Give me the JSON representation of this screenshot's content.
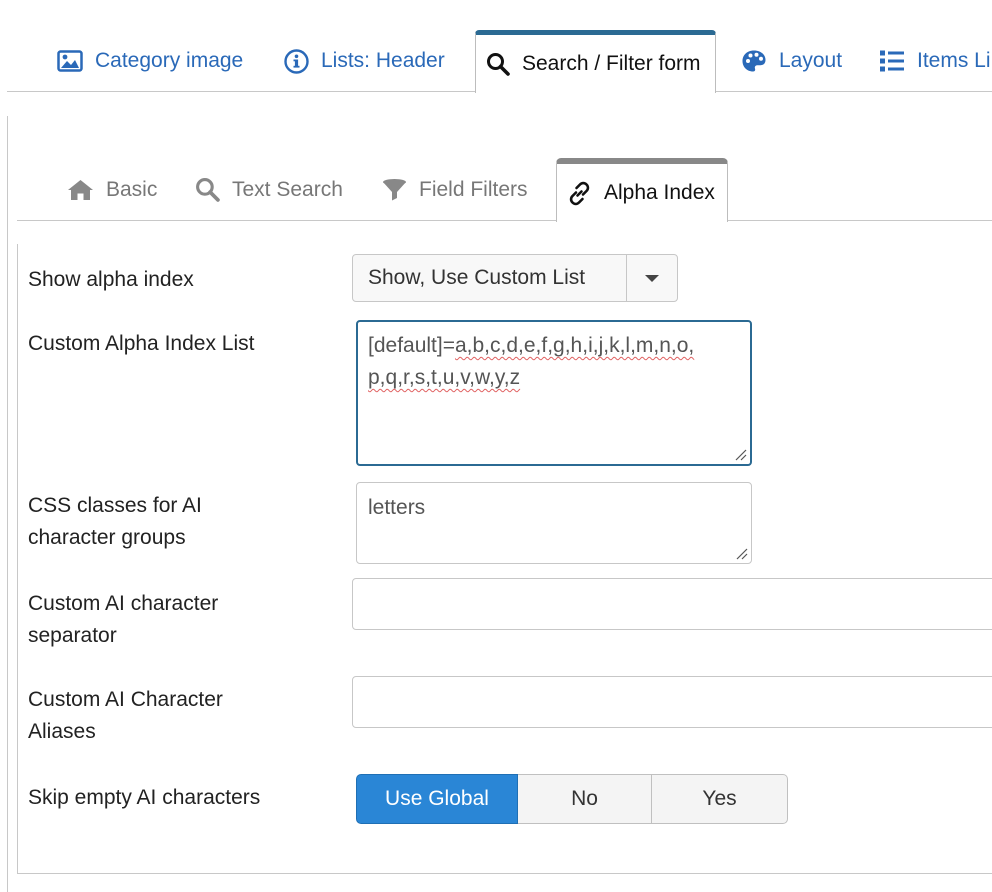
{
  "top_tabs": [
    {
      "label": "Category image",
      "icon": "image-icon"
    },
    {
      "label": "Lists: Header",
      "icon": "info-circle-icon"
    },
    {
      "label": "Search / Filter form",
      "icon": "search-icon",
      "active": true
    },
    {
      "label": "Layout",
      "icon": "palette-icon"
    },
    {
      "label": "Items Li",
      "icon": "list-icon"
    }
  ],
  "sub_tabs": [
    {
      "label": "Basic",
      "icon": "home-icon"
    },
    {
      "label": "Text Search",
      "icon": "search-icon"
    },
    {
      "label": "Field Filters",
      "icon": "filter-icon"
    },
    {
      "label": "Alpha Index",
      "icon": "link-icon",
      "active": true
    }
  ],
  "form": {
    "show_alpha_index": {
      "label": "Show alpha index",
      "value": "Show, Use Custom List"
    },
    "custom_list": {
      "label": "Custom Alpha Index List",
      "prefix": "[default]=",
      "line1_rest": "a,b,c,d,e,f,g,h,i,j,k,l,m,n,o,",
      "line2": "p,q,r,s,t,u,v,w,y,z"
    },
    "css_classes": {
      "label": "CSS classes for AI character groups",
      "value": "letters"
    },
    "separator": {
      "label": "Custom AI character separator",
      "value": ""
    },
    "aliases": {
      "label": "Custom AI Character Aliases",
      "value": ""
    },
    "skip_empty": {
      "label": "Skip empty AI characters",
      "options": [
        "Use Global",
        "No",
        "Yes"
      ],
      "selected": "Use Global"
    }
  },
  "colors": {
    "link_blue": "#2a69b8",
    "active_tab_top": "#2b6a93",
    "button_active": "#2a86d6",
    "spell_error": "#e06060"
  }
}
